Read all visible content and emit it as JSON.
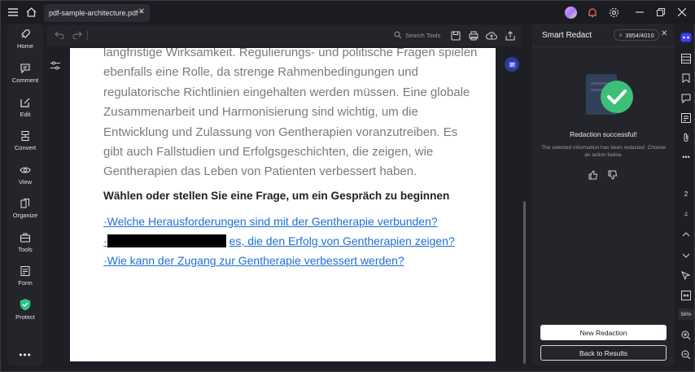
{
  "titlebar": {
    "tab_title": "pdf-sample-architecture.pdf *",
    "tab_close": "✕"
  },
  "sidebar": {
    "items": [
      {
        "label": "Home",
        "icon": "rocket-icon"
      },
      {
        "label": "Comment",
        "icon": "comment-icon"
      },
      {
        "label": "Edit",
        "icon": "edit-icon"
      },
      {
        "label": "Convert",
        "icon": "convert-icon"
      },
      {
        "label": "View",
        "icon": "eye-icon"
      },
      {
        "label": "Organize",
        "icon": "organize-icon"
      },
      {
        "label": "Tools",
        "icon": "toolbox-icon"
      },
      {
        "label": "Form",
        "icon": "form-icon"
      },
      {
        "label": "Protect",
        "icon": "shield-icon"
      }
    ],
    "more": "•••"
  },
  "toolbar": {
    "search_placeholder": "Search Tools"
  },
  "document": {
    "paragraph": "langfristige Wirksamkeit. Regulierungs- und politische Fragen spielen ebenfalls eine Rolle, da strenge Rahmenbedingungen und regulatorische Richtlinien eingehalten werden müssen. Eine globale Zusammenarbeit und Harmonisierung sind wichtig, um die Entwicklung und Zulassung von Gentherapien voranzutreiben. Es gibt auch Fallstudien und Erfolgsgeschichten, die zeigen, wie Gentherapien das Leben von Patienten verbessert haben.",
    "heading": "Wählen oder stellen Sie eine Frage, um ein Gespräch zu beginnen",
    "links": [
      "·Welche Herausforderungen sind mit der Gentherapie verbunden?",
      "es, die den Erfolg von Gentherapien zeigen?",
      "·Wie kann der Zugang zur Gentherapie verbessert werden?"
    ],
    "link2_prefix": "·"
  },
  "panel": {
    "title": "Smart Redact",
    "credits": "3954/4010",
    "close": "✕",
    "success_title": "Redaction successful!",
    "success_desc": "The selected information has been redacted. Choose an action below.",
    "new_redaction": "New Redaction",
    "back_to_results": "Back to Results"
  },
  "rail": {
    "page_current": "2",
    "page_total": "4",
    "zoom": "56%"
  },
  "colors": {
    "accent_green": "#3dbf7a",
    "link_blue": "#1e6fd6",
    "redaction": "#000000"
  }
}
